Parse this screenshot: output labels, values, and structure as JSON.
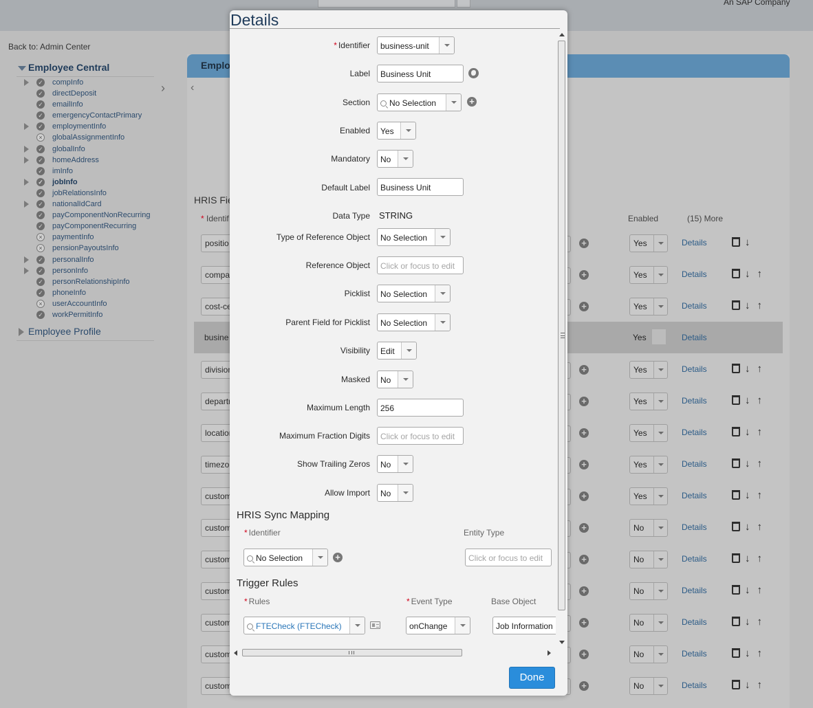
{
  "header": {
    "company_tag": "An SAP Company"
  },
  "back_link": "Back to: Admin Center",
  "tree": {
    "root": "Employee Central",
    "items": [
      {
        "label": "compInfo",
        "expandable": true,
        "status": "ok"
      },
      {
        "label": "directDeposit",
        "expandable": false,
        "status": "ok"
      },
      {
        "label": "emailInfo",
        "expandable": false,
        "status": "ok"
      },
      {
        "label": "emergencyContactPrimary",
        "expandable": false,
        "status": "ok"
      },
      {
        "label": "employmentInfo",
        "expandable": true,
        "status": "ok"
      },
      {
        "label": "globalAssignmentInfo",
        "expandable": false,
        "status": "x"
      },
      {
        "label": "globalInfo",
        "expandable": true,
        "status": "ok"
      },
      {
        "label": "homeAddress",
        "expandable": true,
        "status": "ok"
      },
      {
        "label": "imInfo",
        "expandable": false,
        "status": "ok"
      },
      {
        "label": "jobInfo",
        "expandable": true,
        "status": "ok",
        "bold": true
      },
      {
        "label": "jobRelationsInfo",
        "expandable": false,
        "status": "ok"
      },
      {
        "label": "nationalIdCard",
        "expandable": true,
        "status": "ok"
      },
      {
        "label": "payComponentNonRecurring",
        "expandable": false,
        "status": "ok"
      },
      {
        "label": "payComponentRecurring",
        "expandable": false,
        "status": "ok"
      },
      {
        "label": "paymentInfo",
        "expandable": false,
        "status": "x"
      },
      {
        "label": "pensionPayoutsInfo",
        "expandable": false,
        "status": "x"
      },
      {
        "label": "personalInfo",
        "expandable": true,
        "status": "ok"
      },
      {
        "label": "personInfo",
        "expandable": true,
        "status": "ok"
      },
      {
        "label": "personRelationshipInfo",
        "expandable": false,
        "status": "ok"
      },
      {
        "label": "phoneInfo",
        "expandable": false,
        "status": "ok"
      },
      {
        "label": "userAccountInfo",
        "expandable": false,
        "status": "x"
      },
      {
        "label": "workPermitInfo",
        "expandable": false,
        "status": "ok"
      }
    ],
    "profile": "Employee Profile"
  },
  "main": {
    "panel_title": "Employe",
    "hris_title": "HRIS Fie",
    "id_header": "Identif",
    "enabled_header": "Enabled",
    "more_header": "(15) More",
    "details_link": "Details",
    "rows": [
      {
        "id": "positio",
        "enabled": "Yes",
        "up": false
      },
      {
        "id": "compa",
        "enabled": "Yes",
        "up": true
      },
      {
        "id": "cost-ce",
        "enabled": "Yes",
        "up": true
      },
      {
        "id": "busine",
        "enabled": "Yes",
        "highlight": true
      },
      {
        "id": "division",
        "enabled": "Yes",
        "up": true
      },
      {
        "id": "departr",
        "enabled": "Yes",
        "up": true
      },
      {
        "id": "location",
        "enabled": "Yes",
        "up": true
      },
      {
        "id": "timezo",
        "enabled": "Yes",
        "up": true
      },
      {
        "id": "custom",
        "enabled": "Yes",
        "up": true
      },
      {
        "id": "custom",
        "enabled": "No",
        "up": true
      },
      {
        "id": "custom",
        "enabled": "No",
        "up": true
      },
      {
        "id": "custom",
        "enabled": "No",
        "up": true
      },
      {
        "id": "custom",
        "enabled": "No",
        "up": true
      },
      {
        "id": "custom",
        "enabled": "No",
        "up": true
      },
      {
        "id": "custom",
        "enabled": "No",
        "up": true
      }
    ]
  },
  "modal": {
    "title": "Details",
    "fields": {
      "identifier": {
        "label": "Identifier",
        "value": "business-unit"
      },
      "label": {
        "label": "Label",
        "value": "Business Unit"
      },
      "section": {
        "label": "Section",
        "value": "No Selection"
      },
      "enabled": {
        "label": "Enabled",
        "value": "Yes"
      },
      "mandatory": {
        "label": "Mandatory",
        "value": "No"
      },
      "default_label": {
        "label": "Default Label",
        "value": "Business Unit"
      },
      "data_type": {
        "label": "Data Type",
        "value": "STRING"
      },
      "type_ref_obj": {
        "label": "Type of Reference Object",
        "value": "No Selection"
      },
      "ref_obj": {
        "label": "Reference Object",
        "placeholder": "Click or focus to edit"
      },
      "picklist": {
        "label": "Picklist",
        "value": "No Selection"
      },
      "parent_picklist": {
        "label": "Parent Field for Picklist",
        "value": "No Selection"
      },
      "visibility": {
        "label": "Visibility",
        "value": "Edit"
      },
      "masked": {
        "label": "Masked",
        "value": "No"
      },
      "max_length": {
        "label": "Maximum Length",
        "value": "256"
      },
      "max_fraction": {
        "label": "Maximum Fraction Digits",
        "placeholder": "Click or focus to edit"
      },
      "trailing_zeros": {
        "label": "Show Trailing Zeros",
        "value": "No"
      },
      "allow_import": {
        "label": "Allow Import",
        "value": "No"
      }
    },
    "sync": {
      "title": "HRIS Sync Mapping",
      "identifier_header": "Identifier",
      "entity_header": "Entity Type",
      "identifier_value": "No Selection",
      "entity_placeholder": "Click or focus to edit"
    },
    "trigger": {
      "title": "Trigger Rules",
      "rules_header": "Rules",
      "event_header": "Event Type",
      "base_header": "Base Object",
      "rule_value": "FTECheck (FTECheck)",
      "event_value": "onChange",
      "base_value": "Job Information"
    },
    "done_label": "Done"
  }
}
